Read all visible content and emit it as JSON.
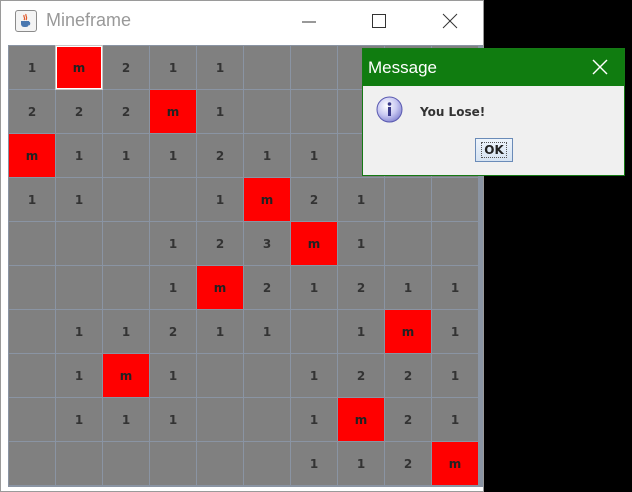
{
  "window": {
    "title": "Mineframe",
    "icons": {
      "app": "java-cup-icon",
      "minimize": "minimize-icon",
      "maximize": "maximize-icon",
      "close": "close-icon"
    }
  },
  "board": {
    "rows": [
      [
        "1",
        "m",
        "2",
        "1",
        "1",
        "",
        "",
        "",
        "",
        ""
      ],
      [
        "2",
        "2",
        "2",
        "m",
        "1",
        "",
        "",
        "",
        "",
        ""
      ],
      [
        "m",
        "1",
        "1",
        "1",
        "2",
        "1",
        "1",
        "",
        "",
        ""
      ],
      [
        "1",
        "1",
        "",
        "",
        "1",
        "m",
        "2",
        "1",
        "",
        ""
      ],
      [
        "",
        "",
        "",
        "1",
        "2",
        "3",
        "m",
        "1",
        "",
        ""
      ],
      [
        "",
        "",
        "",
        "1",
        "m",
        "2",
        "1",
        "2",
        "1",
        "1"
      ],
      [
        "",
        "1",
        "1",
        "2",
        "1",
        "1",
        "",
        "1",
        "m",
        "1"
      ],
      [
        "",
        "1",
        "m",
        "1",
        "",
        "",
        "1",
        "2",
        "2",
        "1"
      ],
      [
        "",
        "1",
        "1",
        "1",
        "",
        "",
        "1",
        "m",
        "2",
        "1"
      ],
      [
        "",
        "",
        "",
        "",
        "",
        "",
        "1",
        "1",
        "2",
        "m"
      ]
    ],
    "mine_marker": "m",
    "colors": {
      "cell": "#808080",
      "mine": "#ff0000",
      "grid": "#8a94a3"
    }
  },
  "dialog": {
    "title": "Message",
    "message": "You Lose!",
    "ok_label": "OK",
    "icons": {
      "info": "info-icon",
      "close": "close-icon"
    },
    "colors": {
      "titlebar": "#107c10"
    }
  }
}
